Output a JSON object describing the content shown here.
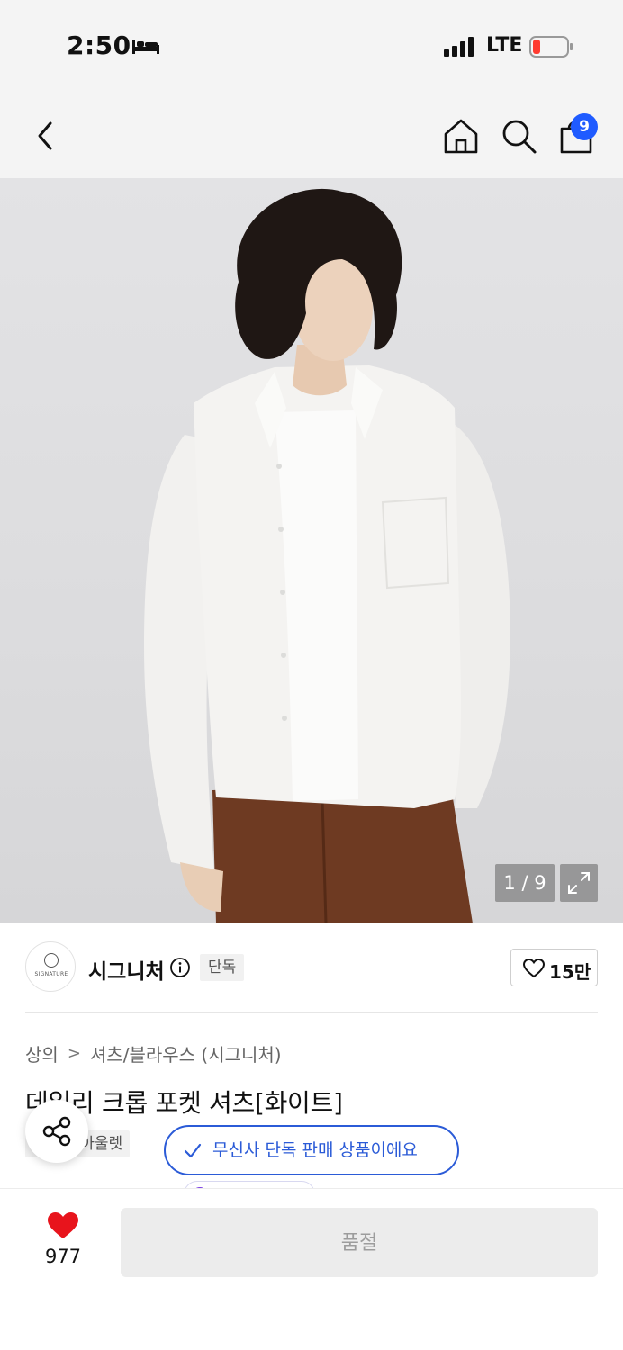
{
  "status_bar": {
    "time": "2:50",
    "network": "LTE"
  },
  "nav": {
    "cart_count": "9"
  },
  "gallery": {
    "counter": "1 / 9"
  },
  "brand": {
    "logo_text": "SIGNATURE",
    "name": "시그니처",
    "tag": "단독",
    "likes": "15만"
  },
  "breadcrumb": {
    "level1": "상의",
    "separator": ">",
    "level2": "셔츠/블라우스 (시그니처)"
  },
  "product": {
    "title": "데일리 크롭 포켓 셔츠[화이트]",
    "tags": [
      "단독",
      "아울렛"
    ]
  },
  "toast": {
    "message": "무신사 단독 판매 상품이에요"
  },
  "bottom": {
    "wish_count": "977",
    "buy_label": "품절"
  },
  "colors": {
    "accent_blue": "#2b5bd7",
    "badge_blue": "#1f5bff",
    "heart_red": "#e8141c"
  }
}
